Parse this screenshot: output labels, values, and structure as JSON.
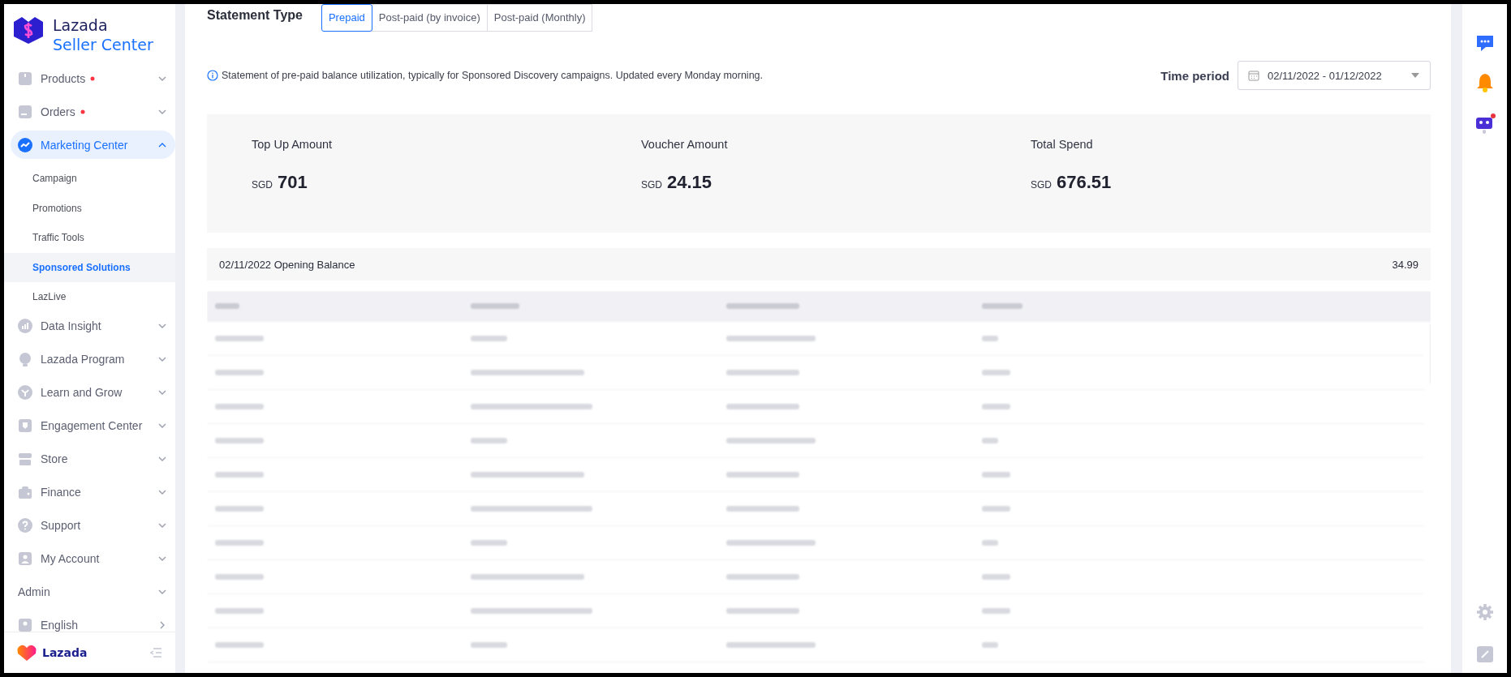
{
  "sidebar": {
    "brand": {
      "line1": "Lazada",
      "line2": "Seller Center"
    },
    "items": [
      {
        "kind": "menu",
        "label": "Products",
        "dot": true,
        "expanded": false,
        "selected": false
      },
      {
        "kind": "menu",
        "label": "Orders",
        "dot": true,
        "expanded": false,
        "selected": false
      },
      {
        "kind": "menu",
        "label": "Marketing Center",
        "dot": false,
        "expanded": true,
        "selected": true,
        "children": [
          {
            "label": "Campaign",
            "selected": false
          },
          {
            "label": "Promotions",
            "selected": false
          },
          {
            "label": "Traffic Tools",
            "selected": false
          },
          {
            "label": "Sponsored Solutions",
            "selected": true
          },
          {
            "label": "LazLive",
            "selected": false
          }
        ]
      },
      {
        "kind": "menu",
        "label": "Data Insight",
        "dot": false,
        "expanded": false,
        "selected": false
      },
      {
        "kind": "menu",
        "label": "Lazada Program",
        "dot": false,
        "expanded": false,
        "selected": false
      },
      {
        "kind": "menu",
        "label": "Learn and Grow",
        "dot": false,
        "expanded": false,
        "selected": false
      },
      {
        "kind": "menu",
        "label": "Engagement Center",
        "dot": false,
        "expanded": false,
        "selected": false
      },
      {
        "kind": "menu",
        "label": "Store",
        "dot": false,
        "expanded": false,
        "selected": false
      },
      {
        "kind": "menu",
        "label": "Finance",
        "dot": false,
        "expanded": false,
        "selected": false
      },
      {
        "kind": "menu",
        "label": "Support",
        "dot": false,
        "expanded": false,
        "selected": false
      },
      {
        "kind": "menu",
        "label": "My Account",
        "dot": false,
        "expanded": false,
        "selected": false
      },
      {
        "kind": "section",
        "label": "Admin",
        "expanded": false
      },
      {
        "kind": "link",
        "label": "English"
      }
    ],
    "footer_logo": "Lazada"
  },
  "statement_type": {
    "label": "Statement Type",
    "tabs": [
      {
        "label": "Prepaid",
        "selected": true
      },
      {
        "label": "Post-paid (by invoice)",
        "selected": false
      },
      {
        "label": "Post-paid (Monthly)",
        "selected": false
      }
    ]
  },
  "info": "Statement of pre-paid balance utilization, typically for Sponsored Discovery campaigns. Updated every Monday morning.",
  "time_period": {
    "label": "Time period",
    "value": "02/11/2022 - 01/12/2022"
  },
  "summary": [
    {
      "label": "Top Up Amount",
      "currency": "SGD",
      "value": "701"
    },
    {
      "label": "Voucher Amount",
      "currency": "SGD",
      "value": "24.15"
    },
    {
      "label": "Total Spend",
      "currency": "SGD",
      "value": "676.51"
    }
  ],
  "opening_balance": {
    "label": "02/11/2022 Opening Balance",
    "value": "34.99"
  },
  "right_rail": {
    "notification_dot": true
  }
}
